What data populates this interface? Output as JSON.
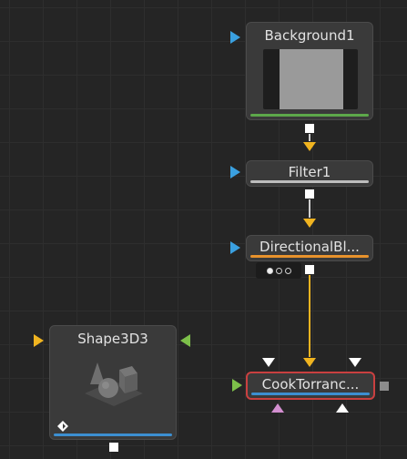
{
  "nodes": {
    "background": {
      "label": "Background1"
    },
    "filter": {
      "label": "Filter1"
    },
    "directional_blur": {
      "label": "DirectionalBl..."
    },
    "shape3d": {
      "label": "Shape3D3"
    },
    "cook_torrance": {
      "label": "CookTorranc..."
    }
  },
  "colors": {
    "canvas": "#252525",
    "node_body": "#3a3a3a",
    "output_green": "#5da84a",
    "output_white": "#bdbdbd",
    "output_orange": "#e8922c",
    "output_blue": "#3c8fd1",
    "selection_red": "#c94040",
    "link_yellow": "#f0b420",
    "input_blue": "#3aa0e0",
    "input_yellow": "#f0b420",
    "input_green": "#7dc04a",
    "input_pink": "#d38fd0"
  },
  "icons": {
    "shape3d_thumbnail": "3d-shapes-icon",
    "shape3d_corner": "diamond-icon",
    "directional_blur_controls": "three-dots-toggle"
  }
}
